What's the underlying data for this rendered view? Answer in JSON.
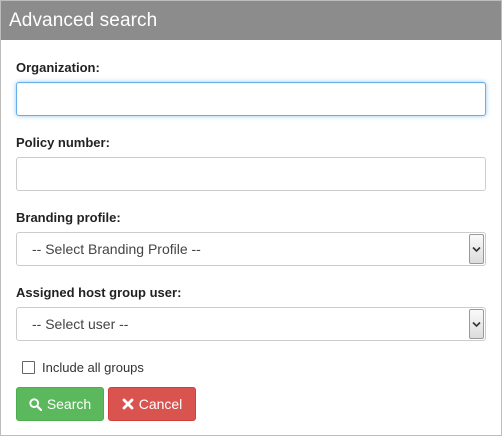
{
  "dialog": {
    "title": "Advanced search"
  },
  "form": {
    "organization": {
      "label": "Organization:",
      "value": "",
      "placeholder": ""
    },
    "policy_number": {
      "label": "Policy number:",
      "value": "",
      "placeholder": ""
    },
    "branding_profile": {
      "label": "Branding profile:",
      "selected": "-- Select Branding Profile --"
    },
    "host_group_user": {
      "label": "Assigned host group user:",
      "selected": "-- Select user --"
    },
    "include_all_groups": {
      "label": "Include all groups",
      "checked": false
    }
  },
  "buttons": {
    "search_label": "Search",
    "cancel_label": "Cancel"
  },
  "icons": {
    "search": "search-icon",
    "cancel": "close-icon",
    "chevron": "chevron-down-icon"
  },
  "colors": {
    "titlebar": "#8c8c8c",
    "search_button": "#5cb85c",
    "cancel_button": "#d9534f",
    "focus_border": "#66afe9"
  }
}
